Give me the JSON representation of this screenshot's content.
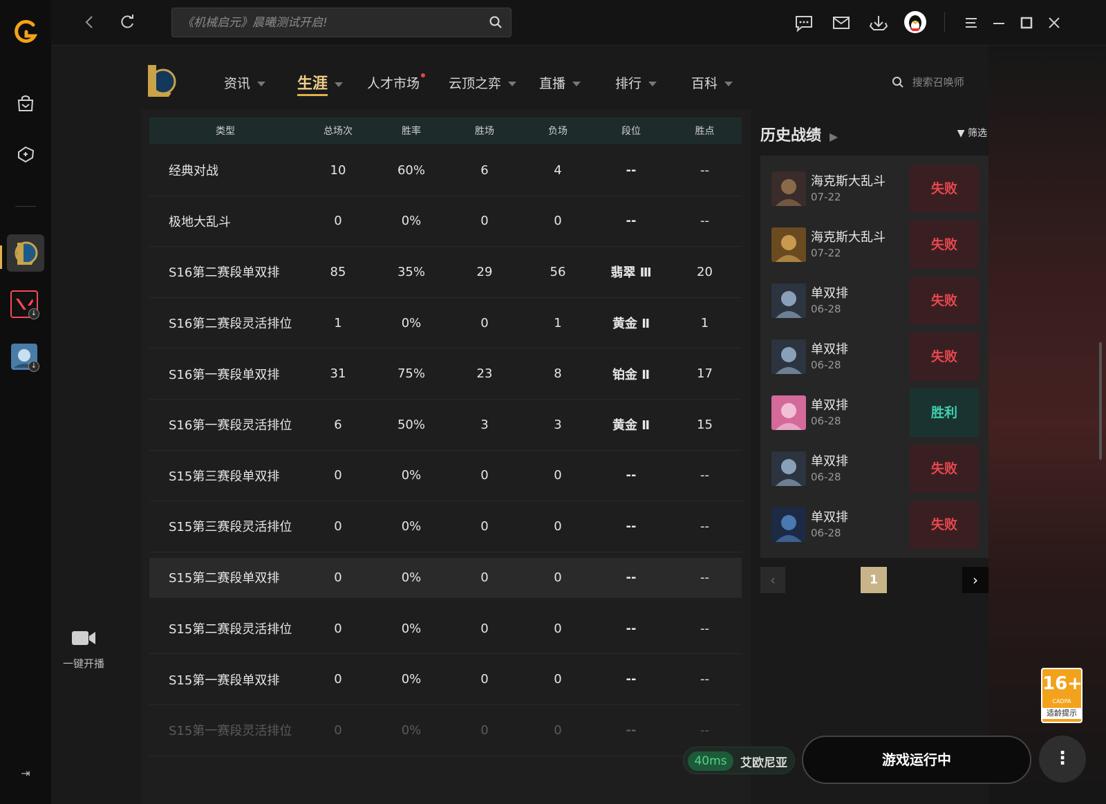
{
  "topbar": {
    "search_placeholder": "《机械启元》晨曦测试开启!"
  },
  "gamenav": {
    "items": [
      {
        "label": "资讯"
      },
      {
        "label": "生涯"
      },
      {
        "label": "人才市场"
      },
      {
        "label": "云顶之弈"
      },
      {
        "label": "直播"
      },
      {
        "label": "排行"
      },
      {
        "label": "百科"
      }
    ],
    "search_placeholder": "搜索召唤师"
  },
  "table": {
    "headers": [
      "类型",
      "总场次",
      "胜率",
      "胜场",
      "负场",
      "段位",
      "胜点"
    ],
    "rows": [
      [
        "经典对战",
        "10",
        "60%",
        "6",
        "4",
        "--",
        "--"
      ],
      [
        "极地大乱斗",
        "0",
        "0%",
        "0",
        "0",
        "--",
        "--"
      ],
      [
        "S16第二赛段单双排",
        "85",
        "35%",
        "29",
        "56",
        "翡翠 Ⅲ",
        "20"
      ],
      [
        "S16第二赛段灵活排位",
        "1",
        "0%",
        "0",
        "1",
        "黄金 Ⅱ",
        "1"
      ],
      [
        "S16第一赛段单双排",
        "31",
        "75%",
        "23",
        "8",
        "铂金 Ⅱ",
        "17"
      ],
      [
        "S16第一赛段灵活排位",
        "6",
        "50%",
        "3",
        "3",
        "黄金 Ⅱ",
        "15"
      ],
      [
        "S15第三赛段单双排",
        "0",
        "0%",
        "0",
        "0",
        "--",
        "--"
      ],
      [
        "S15第三赛段灵活排位",
        "0",
        "0%",
        "0",
        "0",
        "--",
        "--"
      ],
      [
        "S15第二赛段单双排",
        "0",
        "0%",
        "0",
        "0",
        "--",
        "--"
      ],
      [
        "S15第二赛段灵活排位",
        "0",
        "0%",
        "0",
        "0",
        "--",
        "--"
      ],
      [
        "S15第一赛段单双排",
        "0",
        "0%",
        "0",
        "0",
        "--",
        "--"
      ],
      [
        "S15第一赛段灵活排位",
        "0",
        "0%",
        "0",
        "0",
        "--",
        "--"
      ]
    ]
  },
  "history": {
    "title": "历史战绩",
    "filter_label": "筛选",
    "matches": [
      {
        "mode": "海克斯大乱斗",
        "date": "07-22",
        "result": "失败",
        "outcome": "lose"
      },
      {
        "mode": "海克斯大乱斗",
        "date": "07-22",
        "result": "失败",
        "outcome": "lose"
      },
      {
        "mode": "单双排",
        "date": "06-28",
        "result": "失败",
        "outcome": "lose"
      },
      {
        "mode": "单双排",
        "date": "06-28",
        "result": "失败",
        "outcome": "lose"
      },
      {
        "mode": "单双排",
        "date": "06-28",
        "result": "胜利",
        "outcome": "win"
      },
      {
        "mode": "单双排",
        "date": "06-28",
        "result": "失败",
        "outcome": "lose"
      },
      {
        "mode": "单双排",
        "date": "06-28",
        "result": "失败",
        "outcome": "lose"
      }
    ],
    "page": "1"
  },
  "bottom": {
    "live_label": "一键开播",
    "ping": "40ms",
    "server": "艾欧尼亚",
    "run_label": "游戏运行中",
    "age_rating": "16+",
    "age_org": "CADPA",
    "age_label": "适龄提示"
  },
  "colors": {
    "accent": "#e2b04a",
    "lose": "#e8484e",
    "win": "#3fd1b0"
  }
}
